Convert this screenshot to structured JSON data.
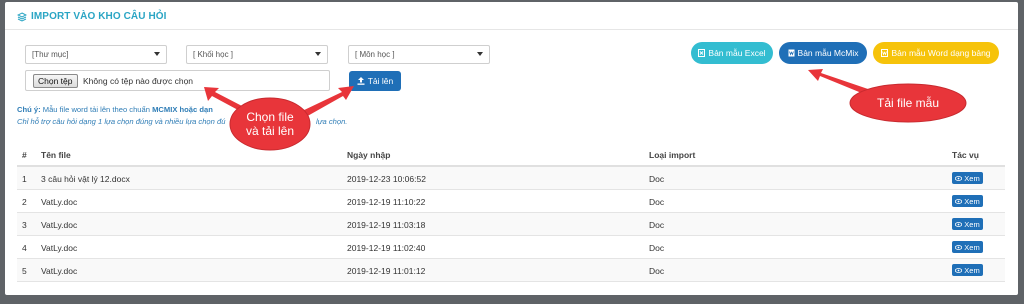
{
  "header": {
    "title": "IMPORT VÀO KHO CÂU HỎI"
  },
  "filters": {
    "folder": "[Thư mục]",
    "grade": "[ Khối học ]",
    "subject": "[ Môn học ]"
  },
  "file": {
    "choose_label": "Chọn tệp",
    "status": "Không có tệp nào được chọn"
  },
  "upload_label": "Tải lên",
  "templates": {
    "excel": "Bản mẫu Excel",
    "mcmix": "Bản mẫu McMix",
    "word": "Bản mẫu Word dạng bảng"
  },
  "notes": {
    "line1_prefix": "Chú ý:",
    "line1_text": "Mẫu file word tải lên theo chuẩn",
    "line1_bold": "MCMIX hoặc dạn",
    "line2_text": "Chỉ hỗ trợ câu hỏi dạng 1 lựa chọn đúng và nhiều lựa chọn đú",
    "line2_tail": "lựa chọn."
  },
  "table": {
    "headers": [
      "#",
      "Tên file",
      "Ngày nhập",
      "Loại import",
      "Tác vụ"
    ],
    "rows": [
      {
        "no": "1",
        "name": "3 câu hỏi vật lý 12.docx",
        "date": "2019-12-23 10:06:52",
        "type": "Doc",
        "action": "Xem"
      },
      {
        "no": "2",
        "name": "VatLy.doc",
        "date": "2019-12-19 11:10:22",
        "type": "Doc",
        "action": "Xem"
      },
      {
        "no": "3",
        "name": "VatLy.doc",
        "date": "2019-12-19 11:03:18",
        "type": "Doc",
        "action": "Xem"
      },
      {
        "no": "4",
        "name": "VatLy.doc",
        "date": "2019-12-19 11:02:40",
        "type": "Doc",
        "action": "Xem"
      },
      {
        "no": "5",
        "name": "VatLy.doc",
        "date": "2019-12-19 11:01:12",
        "type": "Doc",
        "action": "Xem"
      }
    ]
  },
  "callouts": {
    "upload_line1": "Chọn file",
    "upload_line2": "và tải lên",
    "download": "Tải file mẫu"
  },
  "colors": {
    "accent": "#2aa5c4",
    "primary": "#1f6fb7",
    "callout": "#e8353a"
  }
}
